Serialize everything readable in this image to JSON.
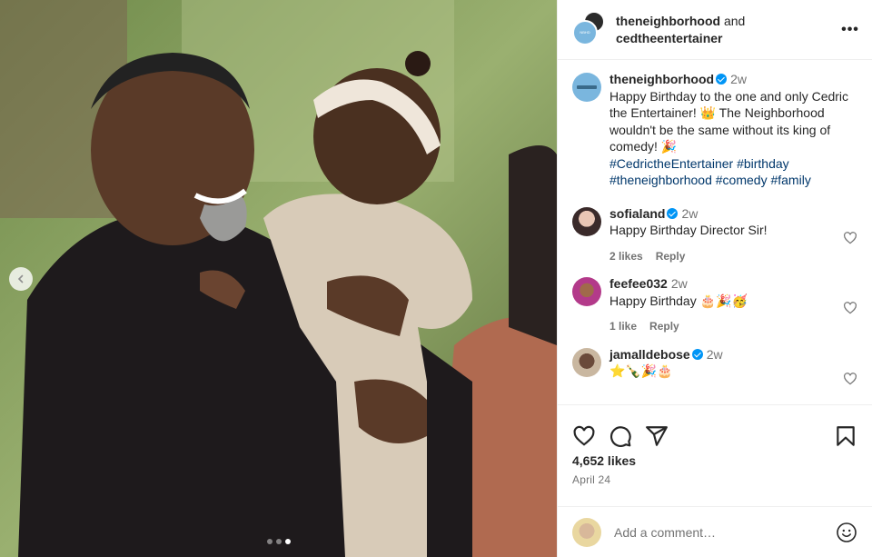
{
  "header": {
    "user1": "theneighborhood",
    "conjunction": "and",
    "user2": "cedtheentertainer",
    "more_label": "•••"
  },
  "caption": {
    "username": "theneighborhood",
    "time": "2w",
    "text": "Happy Birthday to the one and only Cedric the Entertainer! 👑 The Neighborhood wouldn't be the same without its king of comedy! 🎉",
    "hashtags": "#CedrictheEntertainer #birthday #theneighborhood #comedy #family"
  },
  "comments": [
    {
      "username": "sofialand",
      "verified": true,
      "time": "2w",
      "text": "Happy Birthday Director Sir!",
      "likes": "2 likes",
      "reply": "Reply"
    },
    {
      "username": "feefee032",
      "verified": false,
      "time": "2w",
      "text": "Happy Birthday 🎂🎉🥳",
      "likes": "1 like",
      "reply": "Reply"
    },
    {
      "username": "jamalldebose",
      "verified": true,
      "time": "2w",
      "text": "⭐🍾🎉🎂"
    }
  ],
  "post": {
    "likes": "4,652 likes",
    "date": "April 24"
  },
  "add_comment": {
    "placeholder": "Add a comment…"
  },
  "carousel": {
    "slide_count": 3,
    "active_index": 2
  },
  "colors": {
    "link": "#00376b",
    "verified": "#0095f6",
    "muted": "#737373"
  },
  "icons": [
    "heart-icon",
    "comment-icon",
    "share-icon",
    "bookmark-icon",
    "emoji-icon",
    "chevron-left-icon",
    "more-icon"
  ]
}
